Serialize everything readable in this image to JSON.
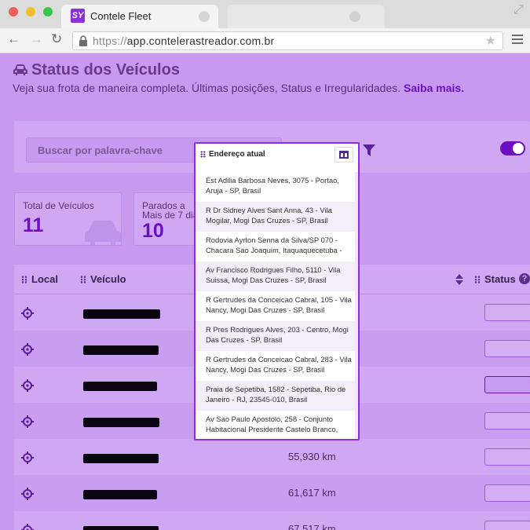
{
  "browser": {
    "tab_title": "Contele Fleet",
    "tab_logo": "SY",
    "url_protocol": "https://",
    "url_host": "app.contelerastreador.com.br"
  },
  "header": {
    "title": "Status dos Veículos",
    "subtitle": "Veja sua frota de maneira completa. Últimas posições, Status e Irregularidades.",
    "learn_more": "Saiba mais."
  },
  "filters": {
    "search_placeholder": "Buscar por palavra-chave"
  },
  "cards": [
    {
      "label": "Total de Veículos",
      "value": "11"
    },
    {
      "label": "Parados a Mais de 7 dias",
      "value": "10"
    }
  ],
  "table": {
    "columns": {
      "local": "Local",
      "vehicle": "Veículo",
      "status": "Status"
    },
    "rows": [
      {
        "km": ""
      },
      {
        "km": ""
      },
      {
        "km": ""
      },
      {
        "km": ""
      },
      {
        "km": "55,930 km"
      },
      {
        "km": "61,617 km"
      },
      {
        "km": "67,517 km"
      }
    ]
  },
  "address_popup": {
    "title": "Endereço atual",
    "items": [
      "Est Adilia Barbosa Neves, 3075 - Portao, Aruja - SP, Brasil",
      "R Dr Sidney Alves Sant Anna, 43 - Vila Mogilar, Mogi Das Cruzes - SP, Brasil",
      "Rodovia Ayrton Senna da Silva/SP 070 - Chacara Sao Joaquim, Itaquaquecetuba -",
      "Av Francisco Rodrigues Filho, 5110 - Vila Suissa, Mogi Das Cruzes - SP, Brasil",
      "R Gertrudes da Conceicao Cabral, 105 - Vila Nancy, Mogi Das Cruzes - SP, Brasil",
      "R Pres Rodrigues Alves, 203 - Centro, Mogi Das Cruzes - SP, Brasil",
      "R Gertrudes da Conceicao Cabral, 283 - Vila Nancy, Mogi Das Cruzes - SP, Brasil",
      "Praia de Sepetiba, 1582 - Sepetiba, Rio de Janeiro - RJ, 23545-010, Brasil",
      "Av Sao Paulo Apostolo, 258 - Conjunto Habitacional Presidente Castelo Branco,"
    ]
  },
  "colors": {
    "accent": "#6a0fc1",
    "overlay": "#c79af0",
    "popup_border": "#8c2fe0"
  }
}
